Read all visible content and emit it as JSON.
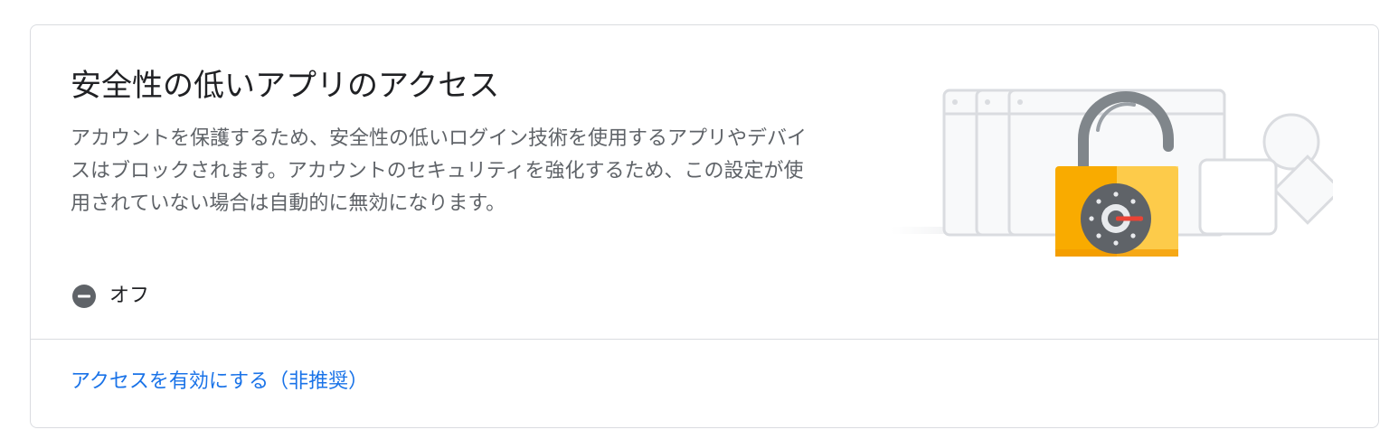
{
  "card": {
    "title": "安全性の低いアプリのアクセス",
    "description": "アカウントを保護するため、安全性の低いログイン技術を使用するアプリやデバイスはブロックされます。アカウントのセキュリティを強化するため、この設定が使用されていない場合は自動的に無効になります。",
    "status": {
      "icon": "minus-circle-icon",
      "label": "オフ"
    },
    "action_link": "アクセスを有効にする（非推奨）",
    "illustration": {
      "icon": "unlocked-padlock-icon"
    }
  },
  "colors": {
    "title": "#202124",
    "text": "#5f6368",
    "link": "#1a73e8",
    "border": "#dadce0",
    "status_icon": "#5f6368",
    "lock_body": "#f9ab00",
    "lock_highlight": "#fdd663",
    "dial": "#5f6368",
    "dial_needle": "#ea4335"
  }
}
